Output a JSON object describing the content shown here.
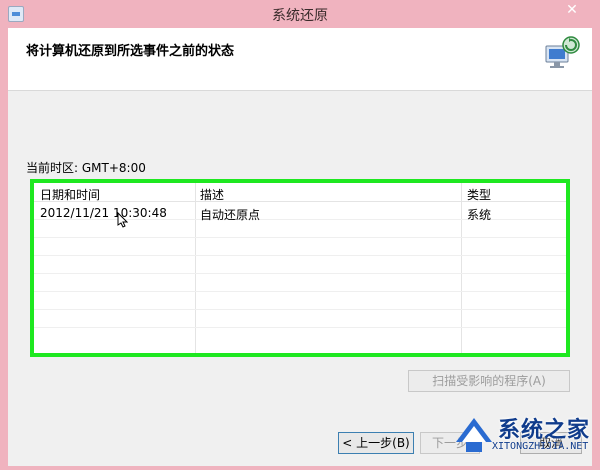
{
  "window": {
    "title": "系统还原",
    "close_glyph": "✕"
  },
  "header": {
    "title": "将计算机还原到所选事件之前的状态",
    "icon": "system-restore-icon"
  },
  "timezone_label": "当前时区: GMT+8:00",
  "table": {
    "columns": [
      "日期和时间",
      "描述",
      "类型"
    ],
    "rows": [
      {
        "datetime": "2012/11/21 10:30:48",
        "description": "自动还原点",
        "type": "系统"
      }
    ],
    "highlight_color": "#1ee820"
  },
  "buttons": {
    "scan": "扫描受影响的程序(A)",
    "back": "< 上一步(B)",
    "next": "下一步",
    "cancel": "取消"
  },
  "watermark": {
    "text": "系统之家",
    "url": "XITONGZHIJIA.NET"
  },
  "colors": {
    "window_frame": "#f0b3bf",
    "dialog_bg": "#f0f0f0"
  }
}
